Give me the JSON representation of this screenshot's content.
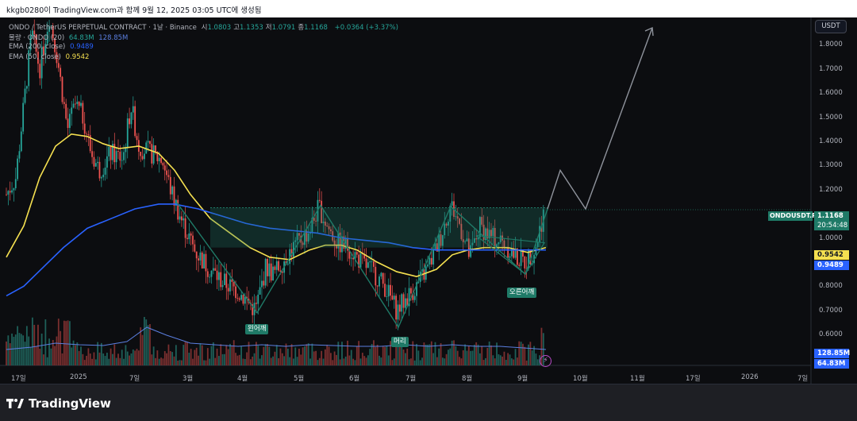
{
  "header": {
    "caption": "kkgb0280이 TradingView.com과 함께 9월 12, 2025 03:05 UTC에 생성됨"
  },
  "legend": {
    "symbol_line": "ONDO / TetherUS PERPETUAL CONTRACT · 1날 · Binance",
    "ohlc": [
      {
        "label": "시",
        "value": "1.0803"
      },
      {
        "label": "고",
        "value": "1.1353"
      },
      {
        "label": "저",
        "value": "1.0791"
      },
      {
        "label": "종",
        "value": "1.1168"
      }
    ],
    "change": "+0.0364 (+3.37%)",
    "volume_label": "물량 · ONDO (20)",
    "volume_value": "64.83M",
    "volume_ma": "128.85M",
    "ema200_label": "EMA (200, close)",
    "ema200_value": "0.9489",
    "ema50_label": "EMA (50, close)",
    "ema50_value": "0.9542"
  },
  "toolbar": {
    "currency_label": "USDT"
  },
  "price_axis": {
    "ticks": [
      "1.8000",
      "1.7000",
      "1.6000",
      "1.5000",
      "1.4000",
      "1.3000",
      "1.2000",
      "1.0000",
      "0.8000",
      "0.7000",
      "0.6000"
    ],
    "tick_values": [
      1.8,
      1.7,
      1.6,
      1.5,
      1.4,
      1.3,
      1.2,
      1.0,
      0.8,
      0.7,
      0.6
    ]
  },
  "time_axis": {
    "labels": [
      "17일",
      "2025",
      "7일",
      "3월",
      "4월",
      "5월",
      "6월",
      "7월",
      "8월",
      "9월",
      "10월",
      "11월",
      "17일",
      "2026",
      "7일"
    ]
  },
  "price_tags": {
    "symbol": "ONDOUSDT.P",
    "last_price": "1.1168",
    "countdown": "20:54:48",
    "ema50": "0.9542",
    "ema200": "0.9489",
    "volume_ma": "128.85M",
    "volume": "64.83M"
  },
  "annotations": {
    "left_shoulder": "왼어깨",
    "head": "머리",
    "right_shoulder": "오른어깨"
  },
  "colors": {
    "candle_up": "#26a69a",
    "candle_down": "#ef5350",
    "ema50": "#f5e050",
    "ema200": "#2962ff",
    "volume_ma": "#5b7fe0",
    "pattern": "#1f7a67",
    "projection": "#8f939c"
  },
  "footer": {
    "brand": "TradingView"
  }
}
